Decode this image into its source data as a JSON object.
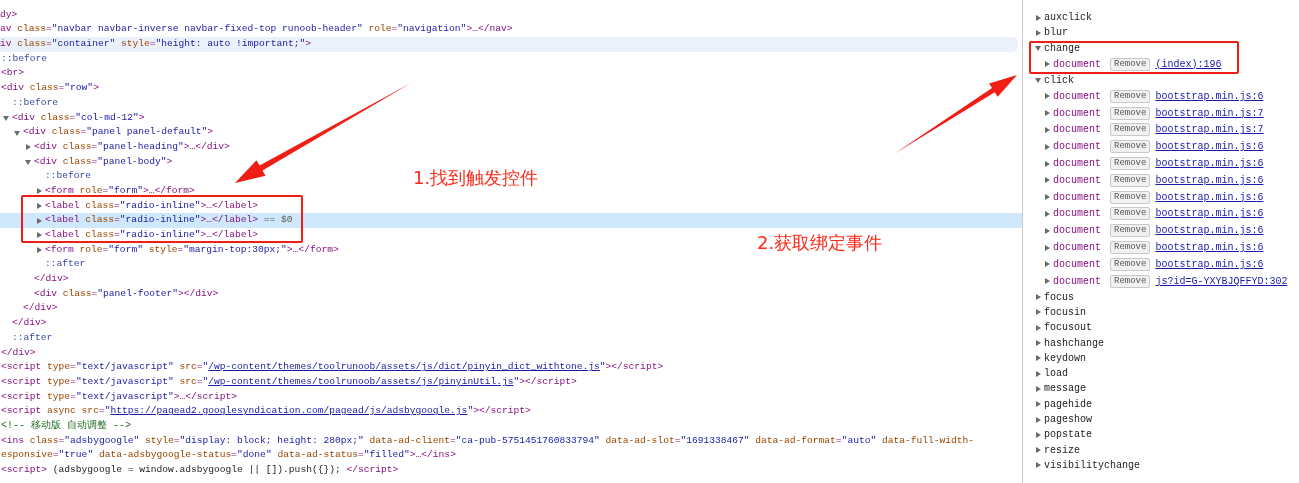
{
  "elements_tree": [
    {
      "lines": [
        [
          {
            "kind": "tag",
            "text": "dy>"
          }
        ]
      ],
      "selected": false
    },
    {
      "lines": [
        [
          {
            "kind": "tag",
            "text": "av"
          },
          {
            "kind": "attr",
            "text": " class"
          },
          {
            "kind": "tag",
            "text": "="
          },
          {
            "kind": "value",
            "text": "\"navbar navbar-inverse navbar-fixed-top runoob-header\""
          },
          {
            "kind": "attr",
            "text": " role"
          },
          {
            "kind": "tag",
            "text": "="
          },
          {
            "kind": "value",
            "text": "\"navigation\""
          },
          {
            "kind": "tag",
            "text": ">…</nav>"
          }
        ]
      ],
      "selected": false
    },
    {
      "lines": [
        [
          {
            "kind": "tag",
            "text": "iv"
          },
          {
            "kind": "attr",
            "text": " class"
          },
          {
            "kind": "tag",
            "text": "="
          },
          {
            "kind": "value",
            "text": "\"container\""
          },
          {
            "kind": "attr",
            "text": " style"
          },
          {
            "kind": "tag",
            "text": "="
          },
          {
            "kind": "value",
            "text": "\"height: auto !important;\""
          },
          {
            "kind": "tag",
            "text": ">"
          }
        ]
      ],
      "selected": false,
      "hovered": true,
      "children": [
        {
          "lines": [
            [
              {
                "kind": "pseudo",
                "text": "::before"
              }
            ]
          ],
          "selected": false
        },
        {
          "lines": [
            [
              {
                "kind": "tag",
                "text": "<br>"
              }
            ]
          ],
          "selected": false
        },
        {
          "lines": [
            [
              {
                "kind": "tag",
                "text": "<div"
              },
              {
                "kind": "attr",
                "text": " class"
              },
              {
                "kind": "tag",
                "text": "="
              },
              {
                "kind": "value",
                "text": "\"row\""
              },
              {
                "kind": "tag",
                "text": ">"
              }
            ]
          ],
          "selected": false,
          "close": [
            {
              "kind": "tag",
              "text": "</div>"
            }
          ],
          "children": [
            {
              "lines": [
                [
                  {
                    "kind": "pseudo",
                    "text": "::before"
                  }
                ]
              ],
              "selected": false
            },
            {
              "lines": [
                [
                  {
                    "kind": "tag",
                    "text": "<div"
                  },
                  {
                    "kind": "attr",
                    "text": " class"
                  },
                  {
                    "kind": "tag",
                    "text": "="
                  },
                  {
                    "kind": "value",
                    "text": "\"col-md-12\""
                  },
                  {
                    "kind": "tag",
                    "text": ">"
                  }
                ]
              ],
              "selected": false,
              "expanded": true,
              "close": [
                {
                  "kind": "tag",
                  "text": "</div>"
                }
              ],
              "children": [
                {
                  "lines": [
                    [
                      {
                        "kind": "tag",
                        "text": "<div"
                      },
                      {
                        "kind": "attr",
                        "text": " class"
                      },
                      {
                        "kind": "tag",
                        "text": "="
                      },
                      {
                        "kind": "value",
                        "text": "\"panel panel-default\""
                      },
                      {
                        "kind": "tag",
                        "text": ">"
                      }
                    ]
                  ],
                  "selected": false,
                  "expanded": true,
                  "close": [
                    {
                      "kind": "tag",
                      "text": "</div>"
                    }
                  ],
                  "children": [
                    {
                      "lines": [
                        [
                          {
                            "kind": "tag",
                            "text": "<div"
                          },
                          {
                            "kind": "attr",
                            "text": " class"
                          },
                          {
                            "kind": "tag",
                            "text": "="
                          },
                          {
                            "kind": "value",
                            "text": "\"panel-heading\""
                          },
                          {
                            "kind": "tag",
                            "text": ">…</div>"
                          }
                        ]
                      ],
                      "selected": false,
                      "expanded": false
                    },
                    {
                      "lines": [
                        [
                          {
                            "kind": "tag",
                            "text": "<div"
                          },
                          {
                            "kind": "attr",
                            "text": " class"
                          },
                          {
                            "kind": "tag",
                            "text": "="
                          },
                          {
                            "kind": "value",
                            "text": "\"panel-body\""
                          },
                          {
                            "kind": "tag",
                            "text": ">"
                          }
                        ]
                      ],
                      "selected": false,
                      "expanded": true,
                      "close": [
                        {
                          "kind": "tag",
                          "text": "</div>"
                        }
                      ],
                      "children": [
                        {
                          "lines": [
                            [
                              {
                                "kind": "pseudo",
                                "text": "::before"
                              }
                            ]
                          ],
                          "selected": false
                        },
                        {
                          "lines": [
                            [
                              {
                                "kind": "tag",
                                "text": "<form"
                              },
                              {
                                "kind": "attr",
                                "text": " role"
                              },
                              {
                                "kind": "tag",
                                "text": "="
                              },
                              {
                                "kind": "value",
                                "text": "\"form\""
                              },
                              {
                                "kind": "tag",
                                "text": ">…</form>"
                              }
                            ]
                          ],
                          "selected": false,
                          "expanded": false
                        },
                        {
                          "lines": [
                            [
                              {
                                "kind": "tag",
                                "text": "<label"
                              },
                              {
                                "kind": "attr",
                                "text": " class"
                              },
                              {
                                "kind": "tag",
                                "text": "="
                              },
                              {
                                "kind": "value",
                                "text": "\"radio-inline\""
                              },
                              {
                                "kind": "tag",
                                "text": ">…</label>"
                              }
                            ]
                          ],
                          "selected": false,
                          "expanded": false
                        },
                        {
                          "lines": [
                            [
                              {
                                "kind": "tag",
                                "text": "<label"
                              },
                              {
                                "kind": "attr",
                                "text": " class"
                              },
                              {
                                "kind": "tag",
                                "text": "="
                              },
                              {
                                "kind": "value",
                                "text": "\"radio-inline\""
                              },
                              {
                                "kind": "tag",
                                "text": ">…</label>"
                              },
                              {
                                "kind": "gray",
                                "text": " == $0"
                              }
                            ]
                          ],
                          "selected": true,
                          "expanded": false
                        },
                        {
                          "lines": [
                            [
                              {
                                "kind": "tag",
                                "text": "<label"
                              },
                              {
                                "kind": "attr",
                                "text": " class"
                              },
                              {
                                "kind": "tag",
                                "text": "="
                              },
                              {
                                "kind": "value",
                                "text": "\"radio-inline\""
                              },
                              {
                                "kind": "tag",
                                "text": ">…</label>"
                              }
                            ]
                          ],
                          "selected": false,
                          "expanded": false
                        },
                        {
                          "lines": [
                            [
                              {
                                "kind": "tag",
                                "text": "<form"
                              },
                              {
                                "kind": "attr",
                                "text": " role"
                              },
                              {
                                "kind": "tag",
                                "text": "="
                              },
                              {
                                "kind": "value",
                                "text": "\"form\""
                              },
                              {
                                "kind": "attr",
                                "text": " style"
                              },
                              {
                                "kind": "tag",
                                "text": "="
                              },
                              {
                                "kind": "value",
                                "text": "\"margin-top:30px;\""
                              },
                              {
                                "kind": "tag",
                                "text": ">…</form>"
                              }
                            ]
                          ],
                          "selected": false,
                          "expanded": false
                        },
                        {
                          "lines": [
                            [
                              {
                                "kind": "pseudo",
                                "text": "::after"
                              }
                            ]
                          ],
                          "selected": false
                        }
                      ]
                    },
                    {
                      "lines": [
                        [
                          {
                            "kind": "tag",
                            "text": "<div"
                          },
                          {
                            "kind": "attr",
                            "text": " class"
                          },
                          {
                            "kind": "tag",
                            "text": "="
                          },
                          {
                            "kind": "value",
                            "text": "\"panel-footer\""
                          },
                          {
                            "kind": "tag",
                            "text": "></div>"
                          }
                        ]
                      ],
                      "selected": false
                    }
                  ]
                }
              ]
            },
            {
              "lines": [
                [
                  {
                    "kind": "pseudo",
                    "text": "::after"
                  }
                ]
              ],
              "selected": false
            }
          ]
        },
        {
          "lines": [
            [
              {
                "kind": "tag",
                "text": "<script"
              },
              {
                "kind": "attr",
                "text": " type"
              },
              {
                "kind": "tag",
                "text": "="
              },
              {
                "kind": "value",
                "text": "\"text/javascript\""
              },
              {
                "kind": "attr",
                "text": " src"
              },
              {
                "kind": "tag",
                "text": "="
              },
              {
                "kind": "value",
                "text": "\""
              },
              {
                "kind": "link",
                "text": "/wp-content/themes/toolrunoob/assets/js/dict/pinyin_dict_withtone.js"
              },
              {
                "kind": "value",
                "text": "\""
              },
              {
                "kind": "tag",
                "text": "></script>"
              }
            ]
          ],
          "selected": false
        },
        {
          "lines": [
            [
              {
                "kind": "tag",
                "text": "<script"
              },
              {
                "kind": "attr",
                "text": " type"
              },
              {
                "kind": "tag",
                "text": "="
              },
              {
                "kind": "value",
                "text": "\"text/javascript\""
              },
              {
                "kind": "attr",
                "text": " src"
              },
              {
                "kind": "tag",
                "text": "="
              },
              {
                "kind": "value",
                "text": "\""
              },
              {
                "kind": "link",
                "text": "/wp-content/themes/toolrunoob/assets/js/pinyinUtil.js"
              },
              {
                "kind": "value",
                "text": "\""
              },
              {
                "kind": "tag",
                "text": "></script>"
              }
            ]
          ],
          "selected": false
        },
        {
          "lines": [
            [
              {
                "kind": "tag",
                "text": "<script"
              },
              {
                "kind": "attr",
                "text": " type"
              },
              {
                "kind": "tag",
                "text": "="
              },
              {
                "kind": "value",
                "text": "\"text/javascript\""
              },
              {
                "kind": "tag",
                "text": ">…</script>"
              }
            ]
          ],
          "selected": false
        },
        {
          "lines": [
            [
              {
                "kind": "tag",
                "text": "<script"
              },
              {
                "kind": "attr",
                "text": " async src"
              },
              {
                "kind": "tag",
                "text": "="
              },
              {
                "kind": "value",
                "text": "\""
              },
              {
                "kind": "link",
                "text": "https://pagead2.googlesyndication.com/pagead/js/adsbygoogle.js"
              },
              {
                "kind": "value",
                "text": "\""
              },
              {
                "kind": "tag",
                "text": "></script>"
              }
            ]
          ],
          "selected": false
        },
        {
          "lines": [
            [
              {
                "kind": "comment",
                "text": "<!-- 移动版 自动调整 -->"
              }
            ]
          ],
          "selected": false
        },
        {
          "lines": [
            [
              {
                "kind": "tag",
                "text": "<ins"
              },
              {
                "kind": "attr",
                "text": " class"
              },
              {
                "kind": "tag",
                "text": "="
              },
              {
                "kind": "value",
                "text": "\"adsbygoogle\""
              },
              {
                "kind": "attr",
                "text": " style"
              },
              {
                "kind": "tag",
                "text": "="
              },
              {
                "kind": "value",
                "text": "\"display: block; height: 280px;\""
              },
              {
                "kind": "attr",
                "text": " data-ad-client"
              },
              {
                "kind": "tag",
                "text": "="
              },
              {
                "kind": "value",
                "text": "\"ca-pub-5751451760833794\""
              },
              {
                "kind": "attr",
                "text": " data-ad-slot"
              },
              {
                "kind": "tag",
                "text": "="
              },
              {
                "kind": "value",
                "text": "\"1691338467\""
              },
              {
                "kind": "attr",
                "text": " data-ad-format"
              },
              {
                "kind": "tag",
                "text": "="
              },
              {
                "kind": "value",
                "text": "\"auto\""
              },
              {
                "kind": "attr",
                "text": " data-full-width-"
              }
            ],
            [
              {
                "kind": "attr",
                "text": "esponsive"
              },
              {
                "kind": "tag",
                "text": "="
              },
              {
                "kind": "value",
                "text": "\"true\""
              },
              {
                "kind": "attr",
                "text": " data-adsbygoogle-status"
              },
              {
                "kind": "tag",
                "text": "="
              },
              {
                "kind": "value",
                "text": "\"done\""
              },
              {
                "kind": "attr",
                "text": " data-ad-status"
              },
              {
                "kind": "tag",
                "text": "="
              },
              {
                "kind": "value",
                "text": "\"filled\""
              },
              {
                "kind": "tag",
                "text": ">…</ins>"
              }
            ]
          ],
          "selected": false
        },
        {
          "lines": [
            [
              {
                "kind": "tag",
                "text": "<script>"
              },
              {
                "kind": "text",
                "text": " (adsbygoogle = window.adsbygoogle || []).push({}); "
              },
              {
                "kind": "tag",
                "text": "</script>"
              }
            ]
          ],
          "selected": false
        }
      ]
    }
  ],
  "event_listeners": [
    {
      "name": "auxclick",
      "expanded": false
    },
    {
      "name": "blur",
      "expanded": false
    },
    {
      "name": "change",
      "expanded": true,
      "listeners": [
        {
          "target": "document",
          "button": "Remove",
          "source": "(index):196"
        }
      ]
    },
    {
      "name": "click",
      "expanded": true,
      "listeners": [
        {
          "target": "document",
          "button": "Remove",
          "source": "bootstrap.min.js:6"
        },
        {
          "target": "document",
          "button": "Remove",
          "source": "bootstrap.min.js:7"
        },
        {
          "target": "document",
          "button": "Remove",
          "source": "bootstrap.min.js:7"
        },
        {
          "target": "document",
          "button": "Remove",
          "source": "bootstrap.min.js:6"
        },
        {
          "target": "document",
          "button": "Remove",
          "source": "bootstrap.min.js:6"
        },
        {
          "target": "document",
          "button": "Remove",
          "source": "bootstrap.min.js:6"
        },
        {
          "target": "document",
          "button": "Remove",
          "source": "bootstrap.min.js:6"
        },
        {
          "target": "document",
          "button": "Remove",
          "source": "bootstrap.min.js:6"
        },
        {
          "target": "document",
          "button": "Remove",
          "source": "bootstrap.min.js:6"
        },
        {
          "target": "document",
          "button": "Remove",
          "source": "bootstrap.min.js:6"
        },
        {
          "target": "document",
          "button": "Remove",
          "source": "bootstrap.min.js:6"
        },
        {
          "target": "document",
          "button": "Remove",
          "source": "js?id=G-YXYBJQFFYD:302"
        }
      ]
    },
    {
      "name": "focus",
      "expanded": false
    },
    {
      "name": "focusin",
      "expanded": false
    },
    {
      "name": "focusout",
      "expanded": false
    },
    {
      "name": "hashchange",
      "expanded": false
    },
    {
      "name": "keydown",
      "expanded": false
    },
    {
      "name": "load",
      "expanded": false
    },
    {
      "name": "message",
      "expanded": false
    },
    {
      "name": "pagehide",
      "expanded": false
    },
    {
      "name": "pageshow",
      "expanded": false
    },
    {
      "name": "popstate",
      "expanded": false
    },
    {
      "name": "resize",
      "expanded": false
    },
    {
      "name": "visibilitychange",
      "expanded": false
    }
  ],
  "annotations": [
    {
      "text": "1.找到触发控件"
    },
    {
      "text": "2.获取绑定事件"
    }
  ]
}
